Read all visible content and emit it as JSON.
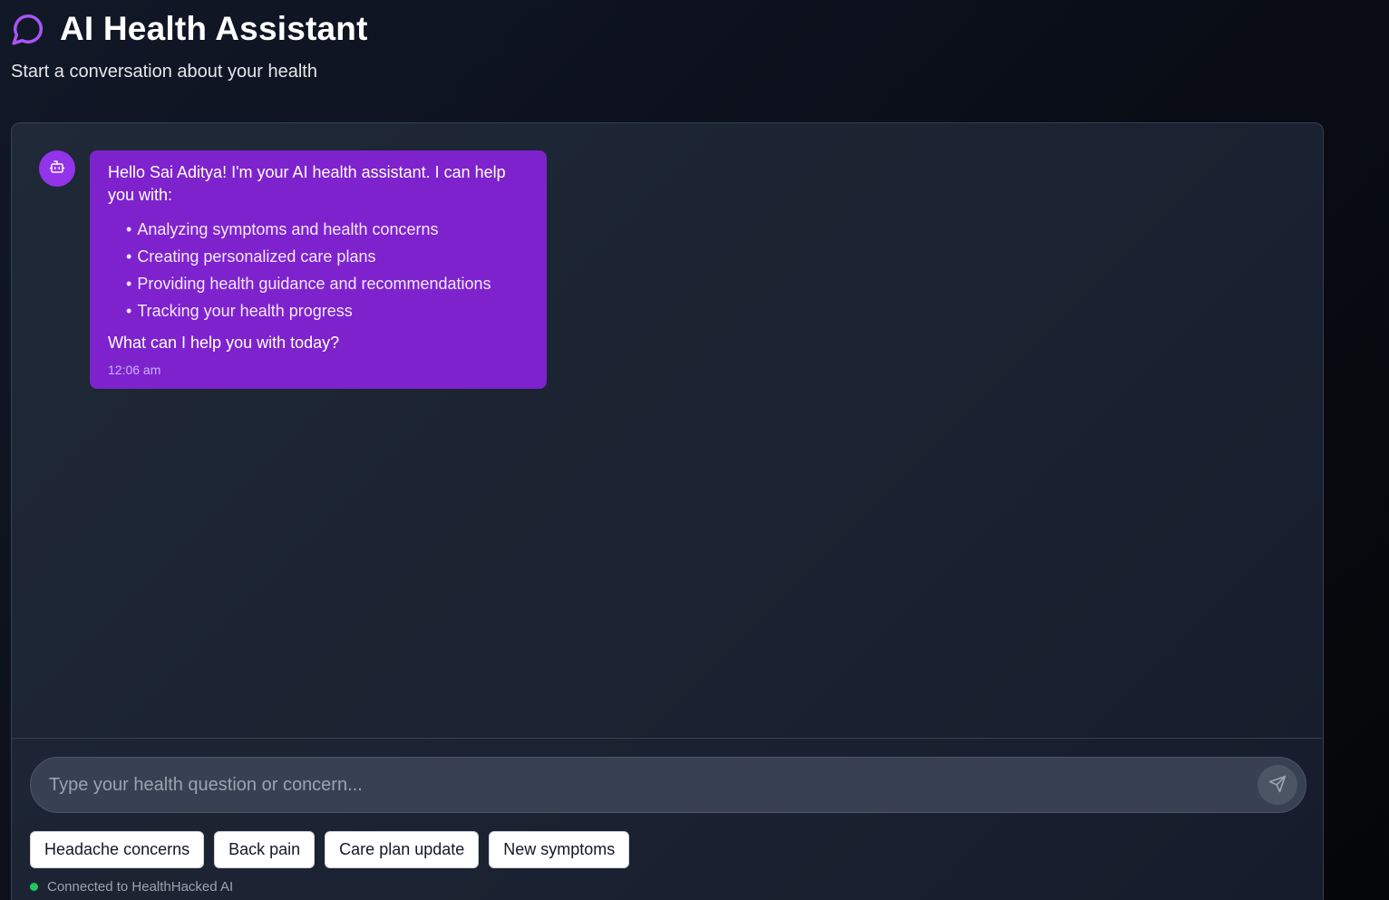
{
  "header": {
    "title": "AI Health Assistant",
    "subtitle": "Start a conversation about your health",
    "icon": "chat-bubble-icon"
  },
  "colors": {
    "accent": "#9333ea",
    "bubble": "#7e22ce",
    "status_online": "#22c55e"
  },
  "messages": [
    {
      "sender": "bot",
      "avatar_icon": "bot-icon",
      "intro": "Hello Sai Aditya! I'm your AI health assistant. I can help you with:",
      "items": [
        "Analyzing symptoms and health concerns",
        "Creating personalized care plans",
        "Providing health guidance and recommendations",
        "Tracking your health progress"
      ],
      "closing": "What can I help you with today?",
      "time": "12:06 am"
    }
  ],
  "input": {
    "placeholder": "Type your health question or concern...",
    "value": "",
    "send_icon": "send-icon"
  },
  "quick_actions": [
    "Headache concerns",
    "Back pain",
    "Care plan update",
    "New symptoms"
  ],
  "status": {
    "text": "Connected to HealthHacked AI"
  },
  "bullet": "•"
}
